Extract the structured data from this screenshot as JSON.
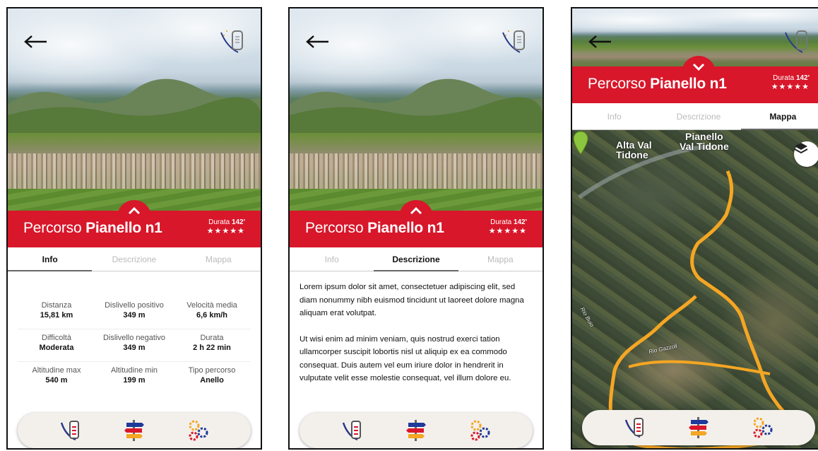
{
  "route": {
    "prefix": "Percorso",
    "name": "Pianello n1",
    "duration_label": "Durata",
    "duration_value": "142'",
    "stars": "★★★★★"
  },
  "tabs": [
    "Info",
    "Descrizione",
    "Mappa"
  ],
  "info": [
    {
      "label": "Distanza",
      "value": "15,81 km"
    },
    {
      "label": "Dislivello positivo",
      "value": "349 m"
    },
    {
      "label": "Velocità media",
      "value": "6,6 km/h"
    },
    {
      "label": "Difficoltà",
      "value": "Moderata"
    },
    {
      "label": "Dislivello negativo",
      "value": "349 m"
    },
    {
      "label": "Durata",
      "value": "2 h 22 min"
    },
    {
      "label": "Altitudine max",
      "value": "540 m"
    },
    {
      "label": "Altitudine min",
      "value": "199 m"
    },
    {
      "label": "Tipo percorso",
      "value": "Anello"
    }
  ],
  "description": {
    "p1": "Lorem ipsum dolor sit amet, consectetuer adipiscing elit, sed diam nonummy nibh euismod tincidunt ut laoreet dolore magna aliquam erat volutpat.",
    "p2": "Ut wisi enim ad minim veniam, quis nostrud exerci tation ullamcorper suscipit lobortis nisl ut aliquip ex ea commodo consequat. Duis autem vel eum iriure dolor in hendrerit in vulputate velit esse molestie consequat, vel illum dolore eu."
  },
  "map": {
    "label_left_1": "Alta Val",
    "label_left_2": "Tidone",
    "label_right_1": "Pianello",
    "label_right_2": "Val Tidone",
    "river_1": "Rio Buio",
    "river_2": "Rio Gazzoli",
    "track_color": "#f5a623"
  },
  "icons": {
    "back": "back-arrow-icon",
    "logo": "region-logo-icon",
    "nav": [
      "region-logo-icon",
      "signpost-icon",
      "gears-icon"
    ],
    "layers": "layers-icon",
    "pin": "map-pin-icon"
  },
  "colors": {
    "brand_red": "#d8172a"
  }
}
